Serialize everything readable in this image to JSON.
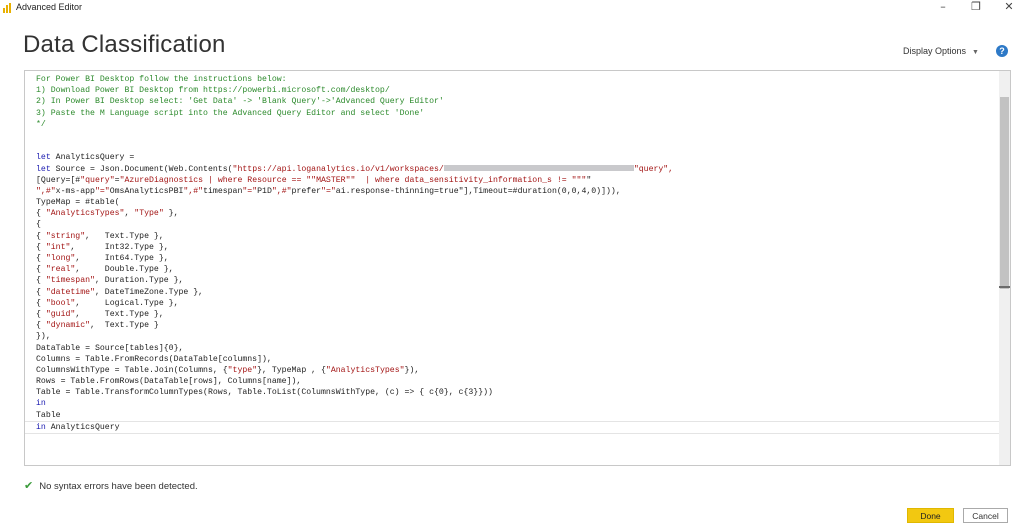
{
  "window": {
    "title": "Advanced Editor",
    "controls": {
      "minimize": "–",
      "restore": "❐",
      "close": "✕"
    }
  },
  "page": {
    "heading": "Data Classification",
    "display_options": "Display Options",
    "help": "?"
  },
  "editor": {
    "lines": [
      [
        "For Power BI Desktop follow the instructions below:"
      ],
      [
        "1) Download Power BI Desktop from https://powerbi.microsoft.com/desktop/"
      ],
      [
        "2) In Power BI Desktop select: 'Get Data' -> 'Blank Query'->'Advanced Query Editor'"
      ],
      [
        "3) Paste the M Language script into the Advanced Query Editor and select 'Done'"
      ],
      [
        "*/"
      ],
      [
        ""
      ],
      [
        ""
      ],
      [
        "let AnalyticsQuery ="
      ],
      [
        "let Source = Json.Document(Web.Contents(",
        "\"https://api.loganalytics.io/v1/workspaces/",
        "\"query\","
      ],
      [
        "[Query=[#\"query\"=",
        "\"AzureDiagnostics | where Resource == \"\"MASTER\"\"  | where data_sensitivity_information_s != \"\"\"\""
      ],
      [
        "\",#\"x-ms-app\"=\"OmsAnalyticsPBI\",#\"timespan\"=\"P1D\",#\"prefer\"=\"ai.response-thinning=true\"],Timeout=#duration(0,0,4,0)])),"
      ],
      [
        "TypeMap = #table("
      ],
      [
        "{ \"AnalyticsTypes\", \"Type\" },"
      ],
      [
        "{"
      ],
      [
        "{ \"string\",   Text.Type },"
      ],
      [
        "{ \"int\",      Int32.Type },"
      ],
      [
        "{ \"long\",     Int64.Type },"
      ],
      [
        "{ \"real\",     Double.Type },"
      ],
      [
        "{ \"timespan\", Duration.Type },"
      ],
      [
        "{ \"datetime\", DateTimeZone.Type },"
      ],
      [
        "{ \"bool\",     Logical.Type },"
      ],
      [
        "{ \"guid\",     Text.Type },"
      ],
      [
        "{ \"dynamic\",  Text.Type }"
      ],
      [
        "}),"
      ],
      [
        "DataTable = Source[tables]{0},"
      ],
      [
        "Columns = Table.FromRecords(DataTable[columns]),"
      ],
      [
        "ColumnsWithType = Table.Join(Columns, {\"type\"}, TypeMap , {\"AnalyticsTypes\"}),"
      ],
      [
        "Rows = Table.FromRows(DataTable[rows], Columns[name]),"
      ],
      [
        "Table = Table.TransformColumnTypes(Rows, Table.ToList(ColumnsWithType, (c) => { c{0}, c{3}}))"
      ],
      [
        "in"
      ],
      [
        "Table"
      ],
      [
        "in AnalyticsQuery"
      ]
    ]
  },
  "status": {
    "message": "No syntax errors have been detected."
  },
  "buttons": {
    "done": "Done",
    "cancel": "Cancel"
  },
  "colors": {
    "accent": "#f2c811",
    "comment": "#2c8a2c",
    "string": "#a31515",
    "keyword": "#1a1ab0",
    "help": "#2d79c7",
    "success": "#3a9b3a"
  }
}
